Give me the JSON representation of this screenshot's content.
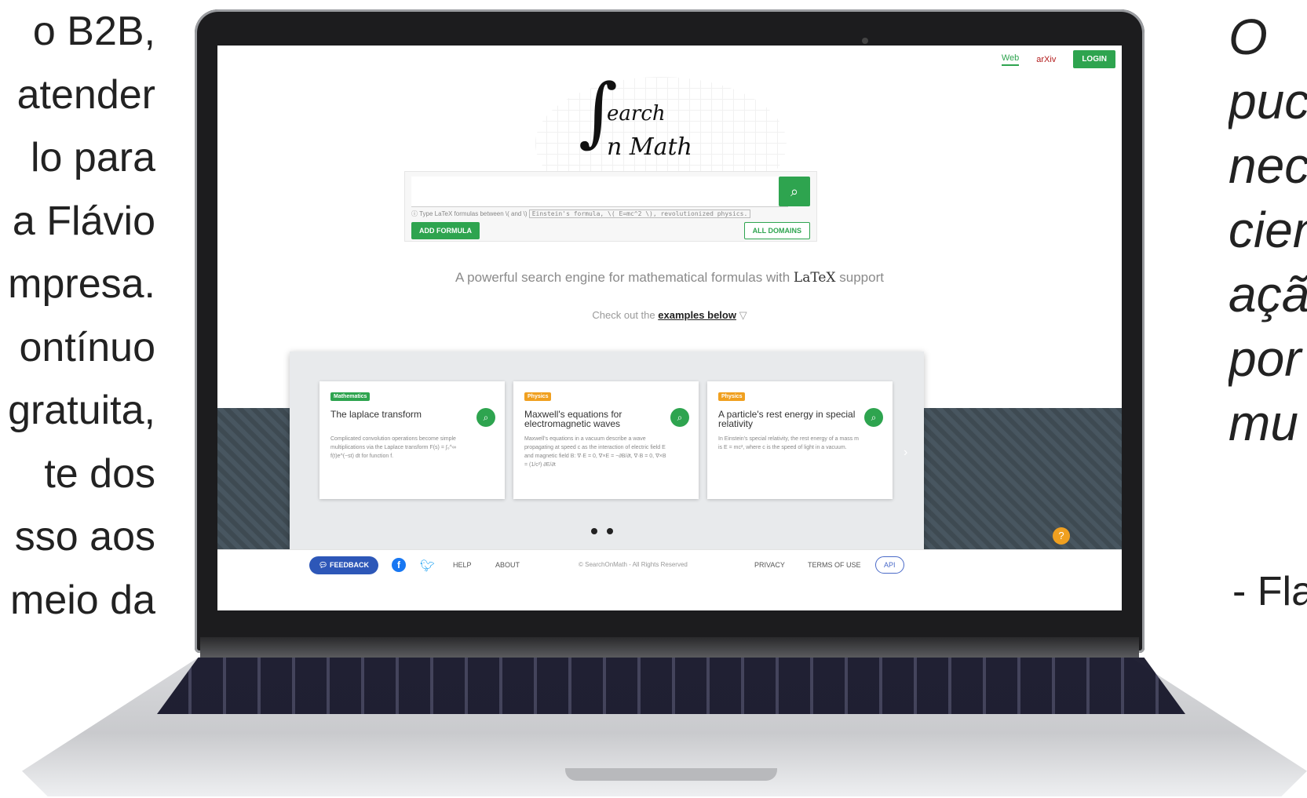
{
  "left_text": [
    "o B2B,",
    "atender",
    "lo para",
    "a Flávio",
    "mpresa.",
    "ontínuo",
    "gratuita,",
    "te dos",
    "sso aos",
    "meio da"
  ],
  "right_text": {
    "lines": [
      "O",
      "puc",
      "nec",
      "cien",
      "açã",
      "por",
      "mu"
    ],
    "author": "- Fla"
  },
  "screen": {
    "nav": {
      "web_tab": "Web",
      "arxiv_tab": "arXiv",
      "login": "LOGIN"
    },
    "logo": {
      "line1": "earch",
      "line2": "n Math"
    },
    "search": {
      "placeholder": "",
      "hint_text": "Type LaTeX formulas between \\( and \\)",
      "hint_example": "Einstein's formula, \\( E=mc^2 \\), revolutionized physics.",
      "add_formula": "ADD FORMULA",
      "all_domains": "ALL DOMAINS"
    },
    "tagline_start": "A powerful search engine for mathematical formulas with",
    "tagline_latex": "LaTeX",
    "tagline_end": "support",
    "examples_prefix": "Check out the",
    "examples_link": "examples below",
    "cards": [
      {
        "badge": "Mathematics",
        "badge_color": "#2ea44f",
        "title": "The laplace transform",
        "desc": "Complicated convolution operations become simple multiplications via the Laplace transform F(s) = ∫₀^∞ f(t)e^(−st) dt for function f."
      },
      {
        "badge": "Physics",
        "badge_color": "#f0a020",
        "title": "Maxwell's equations for electromagnetic waves",
        "desc": "Maxwell's equations in a vacuum describe a wave propagating at speed c as the interaction of electric field E and magnetic field B: ∇·E = 0, ∇×E = −∂B/∂t, ∇·B = 0, ∇×B = (1/c²) ∂E/∂t"
      },
      {
        "badge": "Physics",
        "badge_color": "#f0a020",
        "title": "A particle's rest energy in special relativity",
        "desc": "In Einstein's special relativity, the rest energy of a mass m is E = mc², where c is the speed of light in a vacuum."
      }
    ],
    "footer": {
      "feedback": "FEEDBACK",
      "help": "HELP",
      "about": "ABOUT",
      "copyright": "© SearchOnMath - All Rights Reserved",
      "privacy": "PRIVACY",
      "terms": "TERMS OF USE",
      "api": "API"
    },
    "icons": {
      "search": "search-icon",
      "facebook": "facebook-icon",
      "twitter": "twitter-icon",
      "help": "help-icon",
      "next": "chevron-right-icon"
    }
  }
}
